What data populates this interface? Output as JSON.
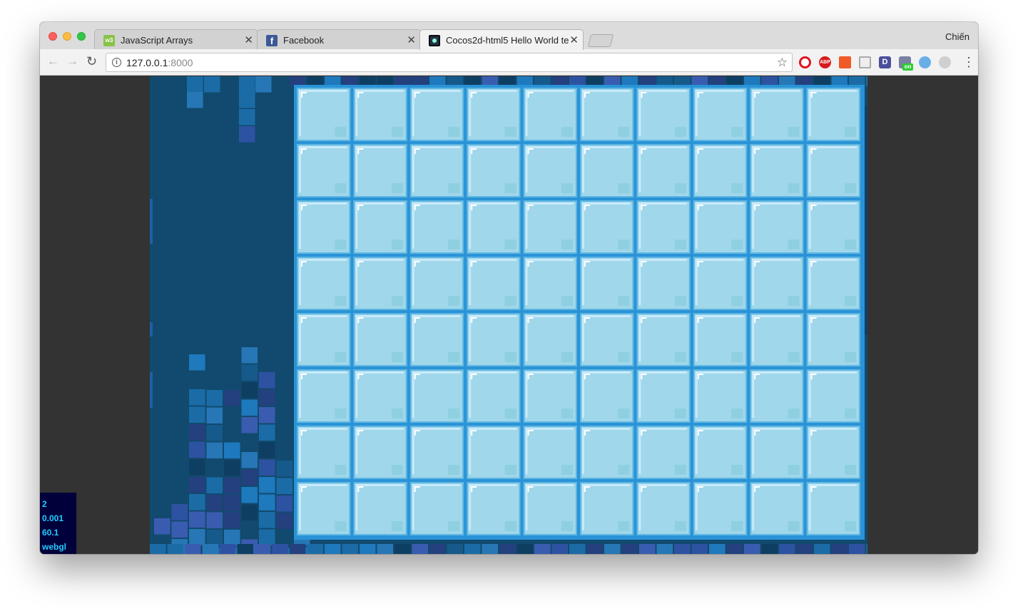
{
  "window": {
    "profile_name": "Chiến",
    "tabs": [
      {
        "title": "JavaScript Arrays",
        "favicon": "w3schools-icon"
      },
      {
        "title": "Facebook",
        "favicon": "facebook-icon"
      },
      {
        "title": "Cocos2d-html5 Hello World te",
        "favicon": "cocos2d-icon",
        "active": true
      }
    ]
  },
  "toolbar": {
    "url_host": "127.0.0.1",
    "url_port": ":8000",
    "extensions": [
      "opera-icon",
      "adblock-plus-icon",
      "bookmark-icon",
      "translate-icon",
      "d-extension-icon",
      "on-extension-icon",
      "bird-icon",
      "skype-icon"
    ]
  },
  "game": {
    "stats": [
      "2",
      "0.001",
      "60.1",
      "webgl"
    ],
    "board": {
      "columns": 10,
      "rows": 8
    },
    "colors": {
      "background": "#114a6e",
      "board_border": "#2a93d7",
      "ice_tile": "#a0d7ea",
      "ice_highlight": "#c6eafa",
      "block_palette": [
        "#2e52a2",
        "#1b6ca6",
        "#2777b6",
        "#24407e",
        "#3a5cb0",
        "#1e79bd",
        "#155a8a",
        "#0e3f63"
      ]
    }
  }
}
